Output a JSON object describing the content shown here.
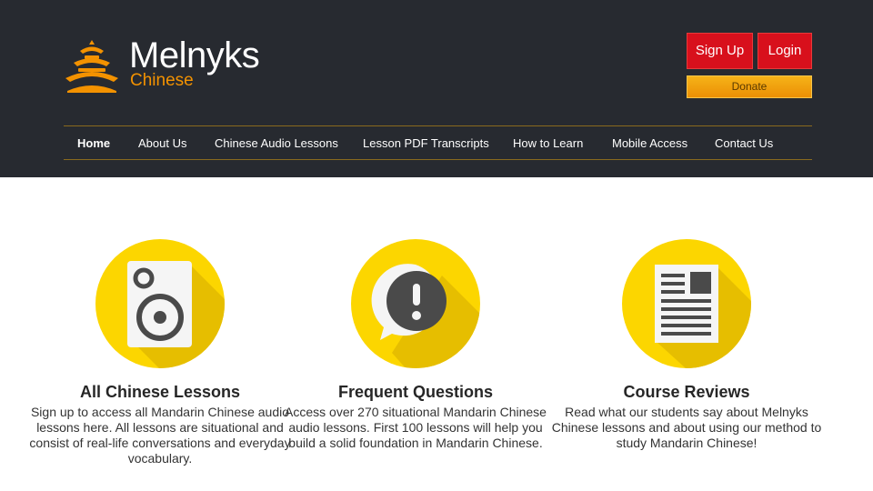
{
  "brand": {
    "name": "Melnyks",
    "sub": "Chinese",
    "accent": "#f39200",
    "header_bg": "#272a30",
    "icon_yellow": "#fcd600"
  },
  "auth": {
    "signup_label": "Sign Up",
    "login_label": "Login",
    "donate_label": "Donate"
  },
  "nav": {
    "items": [
      {
        "label": "Home",
        "active": true
      },
      {
        "label": "About Us"
      },
      {
        "label": "Chinese Audio Lessons"
      },
      {
        "label": "Lesson PDF Transcripts"
      },
      {
        "label": "How to Learn"
      },
      {
        "label": "Mobile Access"
      },
      {
        "label": "Contact Us"
      }
    ]
  },
  "features": [
    {
      "icon": "speaker-icon",
      "title": "All Chinese Lessons",
      "text": "Sign up to access all Mandarin Chinese audio lessons here. All lessons are situational and consist of real-life conversations and everyday vocabulary."
    },
    {
      "icon": "exclamation-icon",
      "title": "Frequent Questions",
      "text": "Access over 270 situational Mandarin Chinese audio lessons. First 100 lessons will help you build a solid foundation in Mandarin Chinese."
    },
    {
      "icon": "document-icon",
      "title": "Course Reviews",
      "text": "Read what our students say about Melnyks Chinese lessons and about using our method to study Mandarin Chinese!"
    }
  ]
}
